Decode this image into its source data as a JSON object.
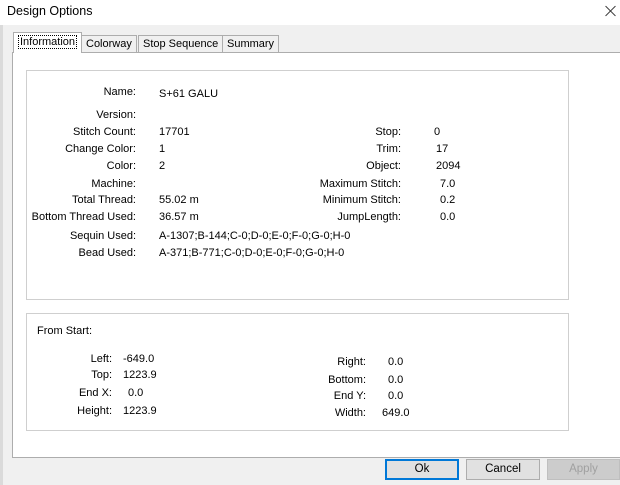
{
  "window": {
    "title": "Design Options"
  },
  "tabs": [
    "Information",
    "Colorway",
    "Stop Sequence",
    "Summary"
  ],
  "info": {
    "name_label": "Name:",
    "name": "S+61 GALU",
    "version_label": "Version:",
    "version": "",
    "stitch_count_label": "Stitch Count:",
    "stitch_count": "17701",
    "change_color_label": "Change Color:",
    "change_color": "1",
    "color_label": "Color:",
    "color": "2",
    "machine_label": "Machine:",
    "machine": "",
    "total_thread_label": "Total Thread:",
    "total_thread": "55.02 m",
    "bottom_thread_label": "Bottom Thread Used:",
    "bottom_thread": "36.57 m",
    "sequin_label": "Sequin Used:",
    "sequin": "A-1307;B-144;C-0;D-0;E-0;F-0;G-0;H-0",
    "bead_label": "Bead Used:",
    "bead": "A-371;B-771;C-0;D-0;E-0;F-0;G-0;H-0",
    "stop_label": "Stop:",
    "stop": "0",
    "trim_label": "Trim:",
    "trim": "17",
    "object_label": "Object:",
    "object": "2094",
    "max_stitch_label": "Maximum Stitch:",
    "max_stitch": "7.0",
    "min_stitch_label": "Minimum Stitch:",
    "min_stitch": "0.2",
    "jump_length_label": "JumpLength:",
    "jump_length": "0.0"
  },
  "from_start": {
    "heading": "From Start:",
    "left_label": "Left:",
    "left": "-649.0",
    "top_label": "Top:",
    "top": "1223.9",
    "end_x_label": "End X:",
    "end_x": "0.0",
    "height_label": "Height:",
    "height": "1223.9",
    "right_label": "Right:",
    "right": "0.0",
    "bottom_label": "Bottom:",
    "bottom": "0.0",
    "end_y_label": "End Y:",
    "end_y": "0.0",
    "width_label": "Width:",
    "width": "649.0"
  },
  "buttons": {
    "ok": "Ok",
    "cancel": "Cancel",
    "apply": "Apply"
  },
  "icons": {
    "close": "close-icon"
  }
}
